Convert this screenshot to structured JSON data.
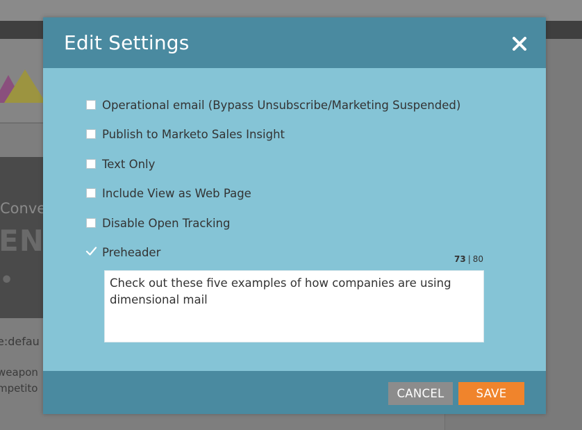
{
  "background": {
    "hero_small_text": "Conve",
    "hero_big_text": "ENS",
    "hero_dot_text": "•",
    "code_text": "e:defau",
    "text_line1": "weapon",
    "text_line2": "mpetito"
  },
  "modal": {
    "title": "Edit Settings",
    "close_icon": "close-icon",
    "options": [
      {
        "label": "Operational email (Bypass Unsubscribe/Marketing Suspended)",
        "checked": false
      },
      {
        "label": "Publish to Marketo Sales Insight",
        "checked": false
      },
      {
        "label": "Text Only",
        "checked": false
      },
      {
        "label": "Include View as Web Page",
        "checked": false
      },
      {
        "label": "Disable Open Tracking",
        "checked": false
      },
      {
        "label": "Preheader",
        "checked": true
      }
    ],
    "counter": {
      "current": "73",
      "separator": "|",
      "max": "80"
    },
    "preheader_text": "Check out these five examples of how companies are using dimensional mail",
    "buttons": {
      "cancel": "CANCEL",
      "save": "SAVE"
    }
  },
  "colors": {
    "header": "#4a8aa0",
    "body": "#85c4d6",
    "save": "#f0842c",
    "cancel": "#8c8c8c"
  }
}
